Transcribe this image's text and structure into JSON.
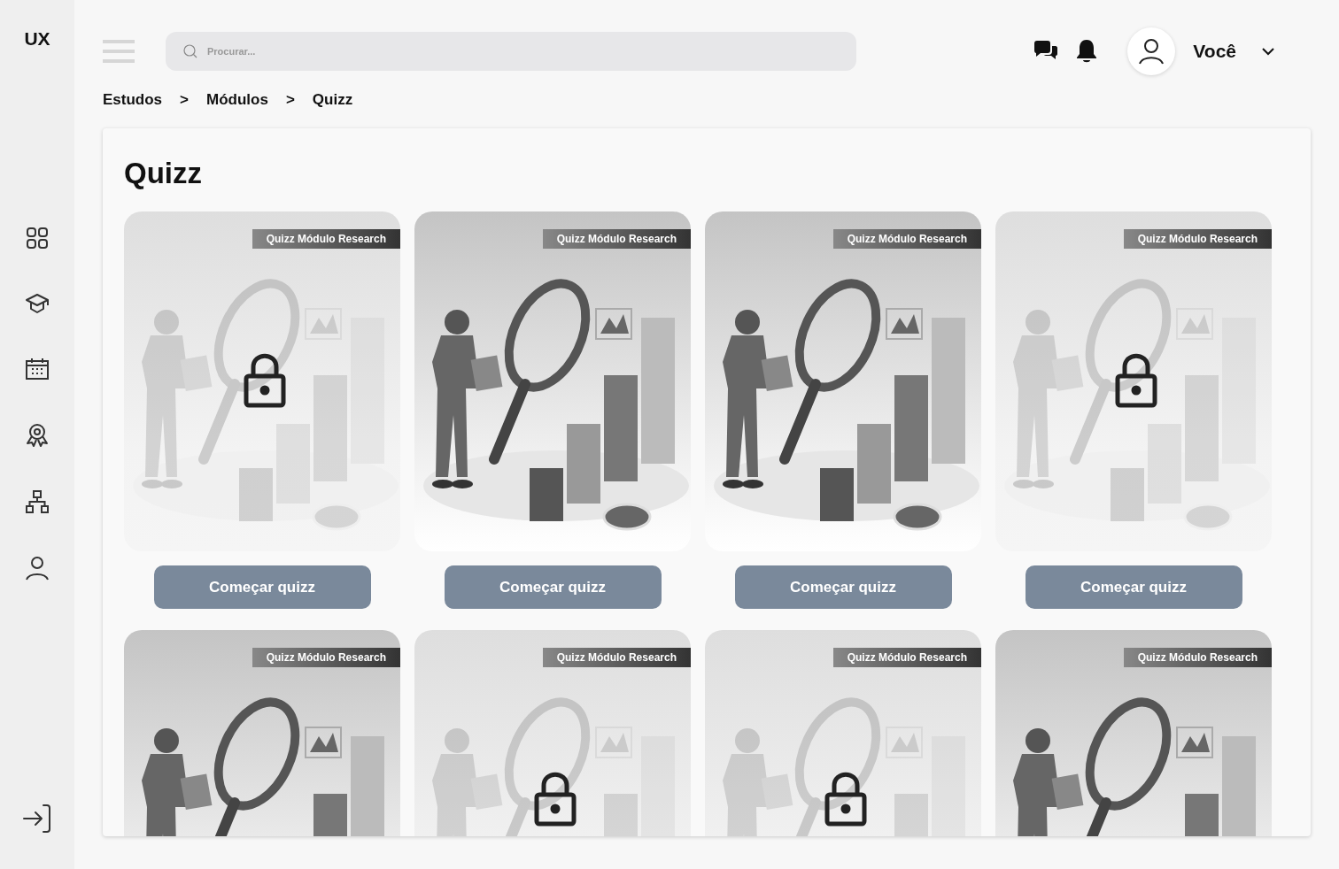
{
  "sidebar": {
    "logo": "UX"
  },
  "header": {
    "search": {
      "placeholder": "Procurar..."
    },
    "user": {
      "name": "Você"
    }
  },
  "breadcrumb": [
    {
      "label": "Estudos"
    },
    {
      "label": ">"
    },
    {
      "label": "Módulos"
    },
    {
      "label": ">"
    },
    {
      "label": "Quizz"
    }
  ],
  "page": {
    "title": "Quizz"
  },
  "cards": [
    {
      "tag": "Quizz Módulo Research",
      "locked": true,
      "button": "Começar quizz"
    },
    {
      "tag": "Quizz Módulo Research",
      "locked": false,
      "button": "Começar quizz"
    },
    {
      "tag": "Quizz Módulo Research",
      "locked": false,
      "button": "Começar quizz"
    },
    {
      "tag": "Quizz Módulo Research",
      "locked": true,
      "button": "Começar quizz"
    },
    {
      "tag": "Quizz Módulo Research",
      "locked": false
    },
    {
      "tag": "Quizz Módulo Research",
      "locked": true
    },
    {
      "tag": "Quizz Módulo Research",
      "locked": true
    },
    {
      "tag": "Quizz Módulo Research",
      "locked": false
    }
  ]
}
